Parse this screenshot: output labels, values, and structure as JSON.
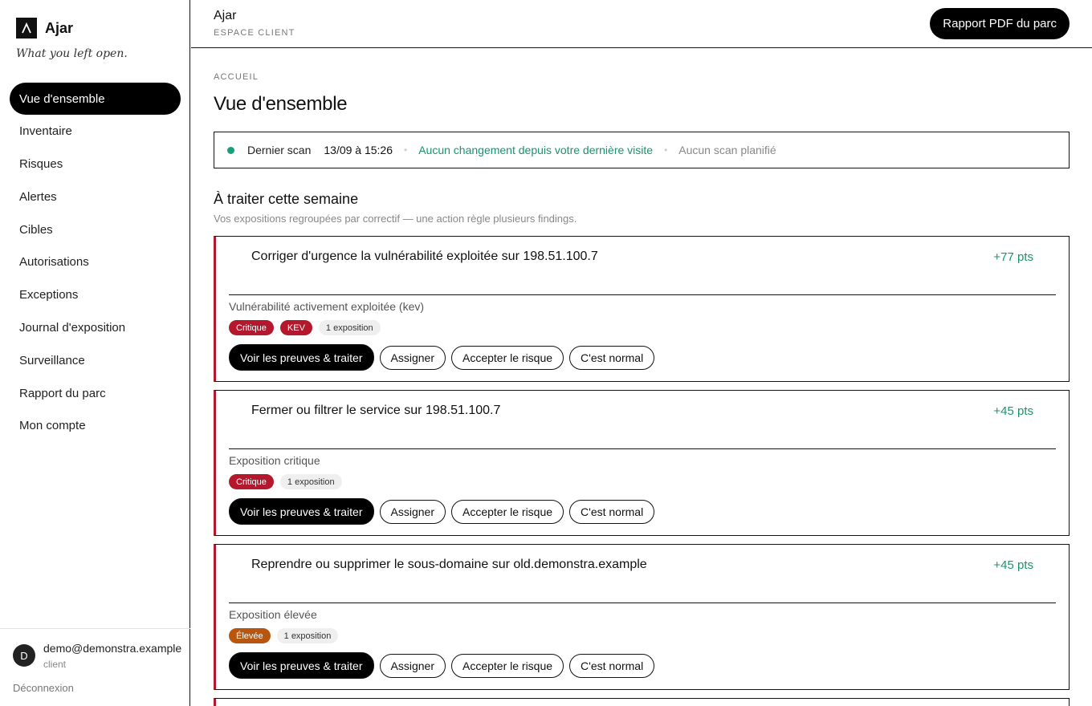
{
  "brand": {
    "name": "Ajar",
    "tagline": "What you left open."
  },
  "sidebar": {
    "items": [
      {
        "label": "Vue d'ensemble",
        "active": true
      },
      {
        "label": "Inventaire"
      },
      {
        "label": "Risques"
      },
      {
        "label": "Alertes"
      },
      {
        "label": "Cibles"
      },
      {
        "label": "Autorisations"
      },
      {
        "label": "Exceptions"
      },
      {
        "label": "Journal d'exposition"
      },
      {
        "label": "Surveillance"
      },
      {
        "label": "Rapport du parc"
      },
      {
        "label": "Mon compte"
      }
    ]
  },
  "user": {
    "initial": "D",
    "email": "demo@demonstra.example",
    "role": "client",
    "logout": "Déconnexion"
  },
  "header": {
    "title": "Ajar",
    "subtitle": "ESPACE CLIENT",
    "pdf_button": "Rapport PDF du parc"
  },
  "main": {
    "breadcrumb": "ACCUEIL",
    "title": "Vue d'ensemble",
    "status": {
      "label": "Dernier scan",
      "time": "13/09 à 15:26",
      "change": "Aucun changement depuis votre dernière visite",
      "schedule": "Aucun scan planifié",
      "dot_color": "#16a07a"
    },
    "section": {
      "title": "À traiter cette semaine",
      "subtitle": "Vos expositions regroupées par correctif — une action règle plusieurs findings."
    },
    "actions": {
      "primary": "Voir les preuves & traiter",
      "assign": "Assigner",
      "accept": "Accepter le risque",
      "normal": "C'est normal"
    },
    "cards": [
      {
        "title": "Corriger d'urgence la vulnérabilité exploitée sur 198.51.100.7",
        "points": "+77 pts",
        "desc": "Vulnérabilité activement exploitée (kev)",
        "tags": [
          {
            "label": "Critique",
            "kind": "crit"
          },
          {
            "label": "KEV",
            "kind": "kev"
          },
          {
            "label": "1 exposition",
            "kind": "exp"
          }
        ]
      },
      {
        "title": "Fermer ou filtrer le service sur 198.51.100.7",
        "points": "+45 pts",
        "desc": "Exposition critique",
        "tags": [
          {
            "label": "Critique",
            "kind": "crit"
          },
          {
            "label": "1 exposition",
            "kind": "exp"
          }
        ]
      },
      {
        "title": "Reprendre ou supprimer le sous-domaine sur old.demonstra.example",
        "points": "+45 pts",
        "desc": "Exposition élevée",
        "tags": [
          {
            "label": "Élevée",
            "kind": "high"
          },
          {
            "label": "1 exposition",
            "kind": "exp"
          }
        ]
      }
    ]
  },
  "colors": {
    "critical": "#b3182d",
    "high": "#b8560f",
    "positive": "#16956f"
  }
}
